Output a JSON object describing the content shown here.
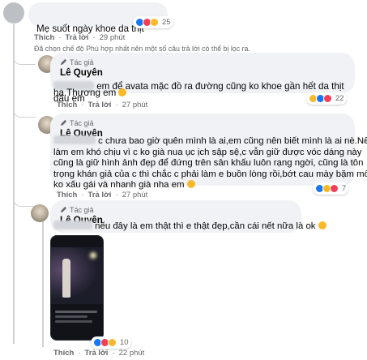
{
  "comment1": {
    "text": "Mẹ suốt ngày khoe da thịt",
    "react_count": "25",
    "actions": {
      "like": "Thích",
      "reply": "Trả lời",
      "time": "29 phút"
    },
    "filter_note": "Đã chọn chế độ Phù hợp nhất nên một số câu trả lời có thể bị lọc ra."
  },
  "reply1": {
    "badge": "Tác giả",
    "name": "Lê Quyên",
    "line1": "em để avata mặc đồ ra đường cũng ko khoe gần hết da thịt đâu em",
    "line2": "ha.Thương em",
    "react_count": "22",
    "actions": {
      "like": "Thích",
      "reply": "Trả lời",
      "time": "27 phút"
    }
  },
  "reply2": {
    "badge": "Tác giả",
    "name": "Lê Quyên",
    "lines": [
      "c chưa bao giờ quên mình là ai,em cũng nên biết mình là ai nè.Nếu c",
      "làm em khó chịu vì c ko già nua ục ịch sập sệ,c vẫn giữ được vóc dáng này",
      "cũng là giữ hình ảnh đẹp để đứng trên sân khấu luôn rạng ngời, cũng là tôn",
      "trọng khán giả của c thì chắc c phải làm e buồn lòng rồi,bớt cau mày bặm môi",
      "ko xấu gái và nhanh già nha em"
    ],
    "react_count": "7",
    "actions": {
      "like": "Thích",
      "reply": "Trả lời",
      "time": "27 phút"
    }
  },
  "reply3": {
    "badge": "Tác giả",
    "name": "Lê Quyên",
    "text": "nếu đây là em thật thì e thật đẹp,cần cái nết nữa là ok",
    "react_count": "10",
    "actions": {
      "like": "Thích",
      "reply": "Trả lời",
      "time": "22 phút"
    }
  },
  "colors": {
    "bubble": "#f0f2f5",
    "meta": "#65676b",
    "like": "#1877f2",
    "love": "#f33e58",
    "haha": "#f7b928"
  },
  "icons": [
    "avatar",
    "author-badge-pen-icon",
    "like-reaction-icon",
    "love-reaction-icon",
    "haha-reaction-icon",
    "care-emoji-icon"
  ]
}
